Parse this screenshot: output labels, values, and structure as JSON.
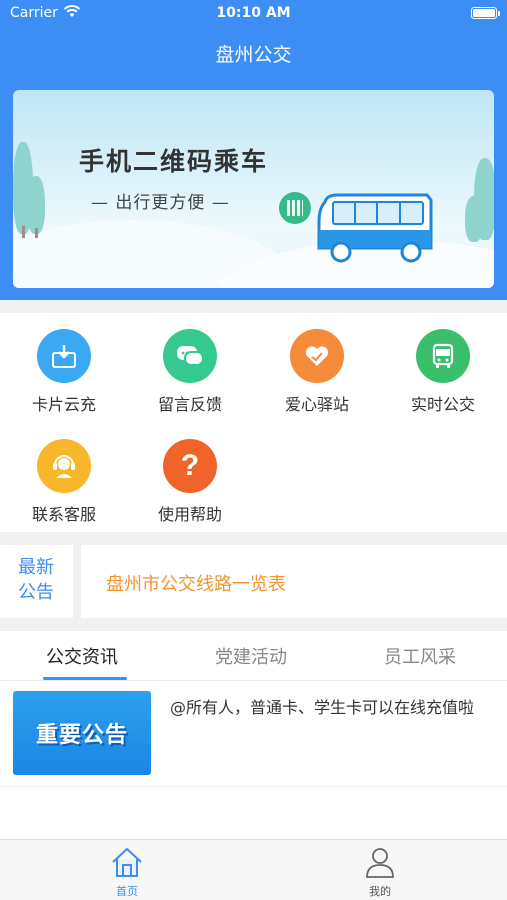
{
  "status_bar": {
    "carrier": "Carrier",
    "time": "10:10 AM"
  },
  "header": {
    "title": "盘州公交"
  },
  "banner": {
    "headline": "手机二维码乘车",
    "subline": "— 出行更方便 —"
  },
  "services": [
    {
      "label": "卡片云充",
      "icon": "card-recharge-icon",
      "color": "#3aa8f2"
    },
    {
      "label": "留言反馈",
      "icon": "message-feedback-icon",
      "color": "#35c98f"
    },
    {
      "label": "爱心驿站",
      "icon": "heart-station-icon",
      "color": "#f58a3b"
    },
    {
      "label": "实时公交",
      "icon": "bus-icon",
      "color": "#39bf6a"
    },
    {
      "label": "联系客服",
      "icon": "customer-service-icon",
      "color": "#f8b62a"
    },
    {
      "label": "使用帮助",
      "icon": "help-icon",
      "color": "#f0642a"
    }
  ],
  "notice": {
    "tag_line1": "最新",
    "tag_line2": "公告",
    "message": "盘州市公交线路一览表"
  },
  "news_tabs": [
    {
      "label": "公交资讯",
      "active": true
    },
    {
      "label": "党建活动",
      "active": false
    },
    {
      "label": "员工风采",
      "active": false
    }
  ],
  "news_items": [
    {
      "thumb_text": "重要公告",
      "text": "@所有人，普通卡、学生卡可以在线充值啦"
    }
  ],
  "tab_bar": [
    {
      "label": "首页",
      "icon": "home-icon",
      "active": true
    },
    {
      "label": "我的",
      "icon": "user-icon",
      "active": false
    }
  ],
  "colors": {
    "primary": "#3c8ef4",
    "accent_orange": "#f0952f"
  }
}
